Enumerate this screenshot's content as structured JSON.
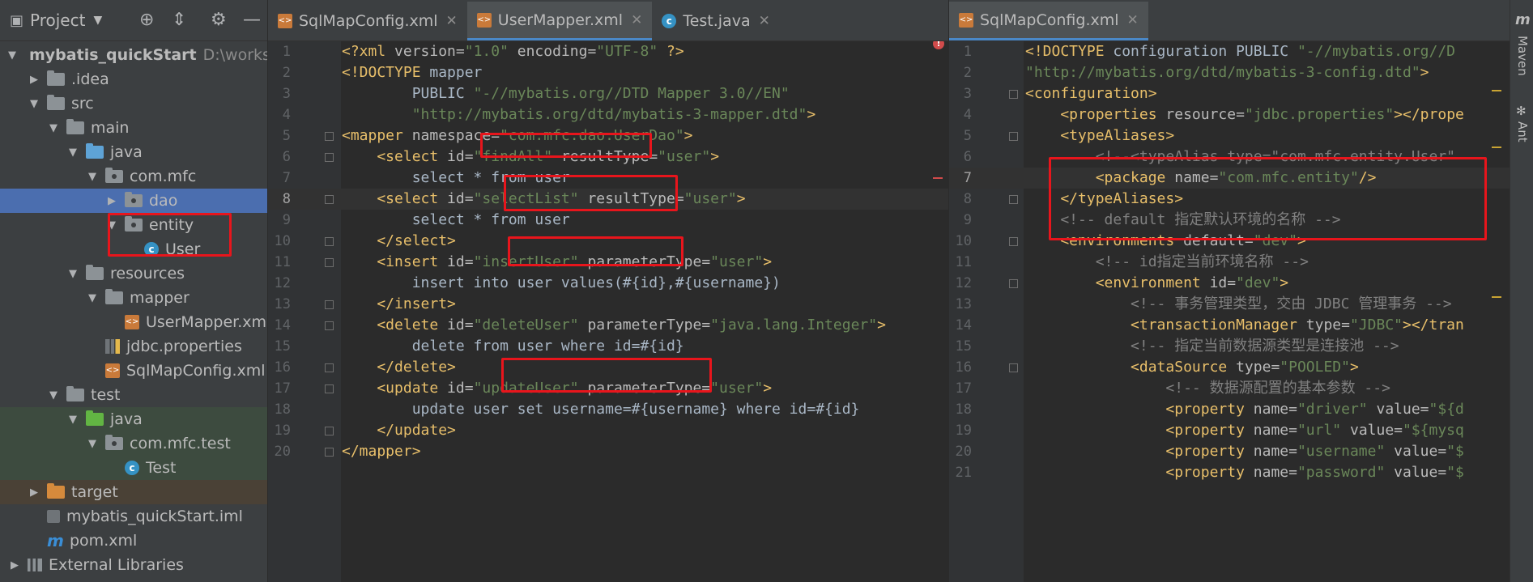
{
  "project_panel": {
    "title": "Project",
    "tree": [
      {
        "indent": 0,
        "arrow": "▼",
        "icon": "module",
        "label": "mybatis_quickStart",
        "extra": "D:\\worksp",
        "bold": true
      },
      {
        "indent": 1,
        "arrow": "▶",
        "icon": "folder-grey",
        "label": ".idea"
      },
      {
        "indent": 1,
        "arrow": "▼",
        "icon": "folder-grey",
        "label": "src"
      },
      {
        "indent": 2,
        "arrow": "▼",
        "icon": "folder-grey",
        "label": "main"
      },
      {
        "indent": 3,
        "arrow": "▼",
        "icon": "folder-blue",
        "label": "java"
      },
      {
        "indent": 4,
        "arrow": "▼",
        "icon": "package",
        "label": "com.mfc"
      },
      {
        "indent": 5,
        "arrow": "▶",
        "icon": "package",
        "label": "dao",
        "state": "selected"
      },
      {
        "indent": 5,
        "arrow": "▼",
        "icon": "package",
        "label": "entity"
      },
      {
        "indent": 6,
        "arrow": "",
        "icon": "class",
        "label": "User"
      },
      {
        "indent": 3,
        "arrow": "▼",
        "icon": "folder-res",
        "label": "resources"
      },
      {
        "indent": 4,
        "arrow": "▼",
        "icon": "folder-grey",
        "label": "mapper"
      },
      {
        "indent": 5,
        "arrow": "",
        "icon": "xml",
        "label": "UserMapper.xm"
      },
      {
        "indent": 4,
        "arrow": "",
        "icon": "properties",
        "label": "jdbc.properties"
      },
      {
        "indent": 4,
        "arrow": "",
        "icon": "xml",
        "label": "SqlMapConfig.xml"
      },
      {
        "indent": 2,
        "arrow": "▼",
        "icon": "folder-grey",
        "label": "test"
      },
      {
        "indent": 3,
        "arrow": "▼",
        "icon": "folder-green",
        "label": "java",
        "state": "test"
      },
      {
        "indent": 4,
        "arrow": "▼",
        "icon": "package",
        "label": "com.mfc.test",
        "state": "test"
      },
      {
        "indent": 5,
        "arrow": "",
        "icon": "testclass",
        "label": "Test",
        "state": "test"
      },
      {
        "indent": 1,
        "arrow": "▶",
        "icon": "folder-orange",
        "label": "target",
        "state": "target"
      },
      {
        "indent": 1,
        "arrow": "",
        "icon": "iml",
        "label": "mybatis_quickStart.iml"
      },
      {
        "indent": 1,
        "arrow": "",
        "icon": "maven",
        "label": "pom.xml"
      },
      {
        "indent": 0,
        "arrow": "▶",
        "icon": "libraries",
        "label": "External Libraries"
      }
    ]
  },
  "left_tabs": [
    {
      "label": "SqlMapConfig.xml",
      "icon": "xml",
      "active": false
    },
    {
      "label": "UserMapper.xml",
      "icon": "xml",
      "active": true
    },
    {
      "label": "Test.java",
      "icon": "class",
      "active": false
    }
  ],
  "right_tabs": [
    {
      "label": "SqlMapConfig.xml",
      "icon": "xml",
      "active": true
    }
  ],
  "left_editor": {
    "lines": [
      [
        [
          "pi",
          "<?xml "
        ],
        [
          "attr",
          "version="
        ],
        [
          "str",
          "\"1.0\""
        ],
        [
          "attr",
          " encoding="
        ],
        [
          "str",
          "\"UTF-8\""
        ],
        [
          "pi",
          " ?>"
        ]
      ],
      [
        [
          "tag",
          "<!DOCTYPE "
        ],
        [
          "txt",
          "mapper"
        ]
      ],
      [
        [
          "txt",
          "        PUBLIC "
        ],
        [
          "str",
          "\"-//mybatis.org//DTD Mapper 3.0//EN\""
        ]
      ],
      [
        [
          "str",
          "        \"http://mybatis.org/dtd/mybatis-3-mapper.dtd\""
        ],
        [
          "tag",
          ">"
        ]
      ],
      [
        [
          "tag",
          "<mapper "
        ],
        [
          "attr",
          "namespace="
        ],
        [
          "str",
          "\"com.mfc.dao.UserDao\""
        ],
        [
          "tag",
          ">"
        ]
      ],
      [
        [
          "tag",
          "    <select "
        ],
        [
          "attr",
          "id="
        ],
        [
          "str",
          "\"findAll\""
        ],
        [
          "attr",
          " resultType="
        ],
        [
          "str",
          "\"user\""
        ],
        [
          "tag",
          ">"
        ]
      ],
      [
        [
          "txt",
          "        select * from user"
        ]
      ],
      [
        [
          "tag",
          "    <select "
        ],
        [
          "attr",
          "id="
        ],
        [
          "str",
          "\"selectList\""
        ],
        [
          "attr",
          " resultType="
        ],
        [
          "str",
          "\"user\""
        ],
        [
          "tag",
          ">"
        ]
      ],
      [
        [
          "txt",
          "        select * from user"
        ]
      ],
      [
        [
          "tag",
          "    </select>"
        ]
      ],
      [
        [
          "tag",
          "    <insert "
        ],
        [
          "attr",
          "id="
        ],
        [
          "str",
          "\"insertUser\""
        ],
        [
          "attr",
          " parameterType="
        ],
        [
          "str",
          "\"user\""
        ],
        [
          "tag",
          ">"
        ]
      ],
      [
        [
          "txt",
          "        insert into user values(#{id},#{username})"
        ]
      ],
      [
        [
          "tag",
          "    </insert>"
        ]
      ],
      [
        [
          "tag",
          "    <delete "
        ],
        [
          "attr",
          "id="
        ],
        [
          "str",
          "\"deleteUser\""
        ],
        [
          "attr",
          " parameterType="
        ],
        [
          "str",
          "\"java.lang.Integer\""
        ],
        [
          "tag",
          ">"
        ]
      ],
      [
        [
          "txt",
          "        delete from user where id=#{id}"
        ]
      ],
      [
        [
          "tag",
          "    </delete>"
        ]
      ],
      [
        [
          "tag",
          "    <update "
        ],
        [
          "attr",
          "id="
        ],
        [
          "str",
          "\"updateUser\""
        ],
        [
          "attr",
          " parameterType="
        ],
        [
          "str",
          "\"user\""
        ],
        [
          "tag",
          ">"
        ]
      ],
      [
        [
          "txt",
          "        update user set username=#{username} where id=#{id}"
        ]
      ],
      [
        [
          "tag",
          "    </update>"
        ]
      ],
      [
        [
          "tag",
          "</mapper>"
        ]
      ]
    ]
  },
  "right_editor": {
    "lines": [
      [
        [
          "tag",
          "<!DOCTYPE "
        ],
        [
          "txt",
          "configuration PUBLIC "
        ],
        [
          "str",
          "\"-//mybatis.org//D"
        ]
      ],
      [
        [
          "str",
          "\"http://mybatis.org/dtd/mybatis-3-config.dtd\""
        ],
        [
          "tag",
          ">"
        ]
      ],
      [
        [
          "tag",
          "<configuration>"
        ]
      ],
      [
        [
          "tag",
          "    <properties "
        ],
        [
          "attr",
          "resource="
        ],
        [
          "str",
          "\"jdbc.properties\""
        ],
        [
          "tag",
          "></prope"
        ]
      ],
      [
        [
          "tag",
          "    <typeAliases>"
        ]
      ],
      [
        [
          "cm",
          "        <!--<typeAlias type=\"com.mfc.entity.User\""
        ]
      ],
      [
        [
          "tag",
          "        <package "
        ],
        [
          "attr",
          "name="
        ],
        [
          "str",
          "\"com.mfc.entity\""
        ],
        [
          "tag",
          "/>"
        ]
      ],
      [
        [
          "tag",
          "    </typeAliases>"
        ]
      ],
      [
        [
          "cm",
          "    <!-- default 指定默认环境的名称 -->"
        ]
      ],
      [
        [
          "tag",
          "    <environments "
        ],
        [
          "attr",
          "default="
        ],
        [
          "str",
          "\"dev\""
        ],
        [
          "tag",
          ">"
        ]
      ],
      [
        [
          "cm",
          "        <!-- id指定当前环境名称 -->"
        ]
      ],
      [
        [
          "tag",
          "        <environment "
        ],
        [
          "attr",
          "id="
        ],
        [
          "str",
          "\"dev\""
        ],
        [
          "tag",
          ">"
        ]
      ],
      [
        [
          "cm",
          "            <!-- 事务管理类型，交由 JDBC 管理事务 -->"
        ]
      ],
      [
        [
          "tag",
          "            <transactionManager "
        ],
        [
          "attr",
          "type="
        ],
        [
          "str",
          "\"JDBC\""
        ],
        [
          "tag",
          "></tran"
        ]
      ],
      [
        [
          "cm",
          "            <!-- 指定当前数据源类型是连接池 -->"
        ]
      ],
      [
        [
          "tag",
          "            <dataSource "
        ],
        [
          "attr",
          "type="
        ],
        [
          "str",
          "\"POOLED\""
        ],
        [
          "tag",
          ">"
        ]
      ],
      [
        [
          "cm",
          "                <!-- 数据源配置的基本参数 -->"
        ]
      ],
      [
        [
          "tag",
          "                <property "
        ],
        [
          "attr",
          "name="
        ],
        [
          "str",
          "\"driver\""
        ],
        [
          "attr",
          " value="
        ],
        [
          "str",
          "\"${d"
        ]
      ],
      [
        [
          "tag",
          "                <property "
        ],
        [
          "attr",
          "name="
        ],
        [
          "str",
          "\"url\""
        ],
        [
          "attr",
          " value="
        ],
        [
          "str",
          "\"${mysq"
        ]
      ],
      [
        [
          "tag",
          "                <property "
        ],
        [
          "attr",
          "name="
        ],
        [
          "str",
          "\"username\""
        ],
        [
          "attr",
          " value="
        ],
        [
          "str",
          "\"$"
        ]
      ],
      [
        [
          "tag",
          "                <property "
        ],
        [
          "attr",
          "name="
        ],
        [
          "str",
          "\"password\""
        ],
        [
          "attr",
          " value="
        ],
        [
          "str",
          "\"$"
        ]
      ]
    ]
  },
  "right_strip": {
    "maven": "Maven",
    "ant": "Ant"
  }
}
